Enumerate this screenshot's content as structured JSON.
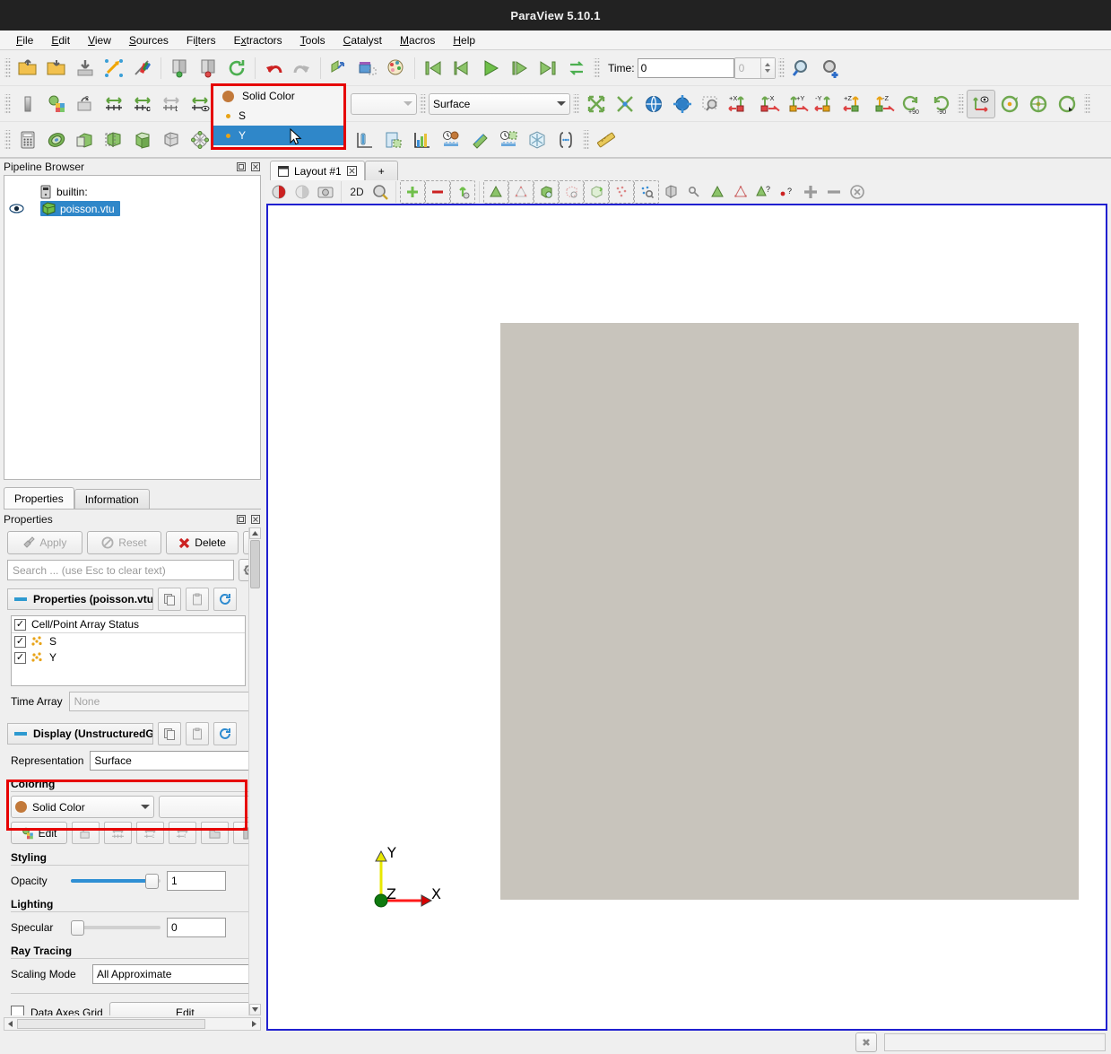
{
  "window": {
    "title": "ParaView 5.10.1"
  },
  "menu": {
    "items": [
      "File",
      "Edit",
      "View",
      "Sources",
      "Filters",
      "Extractors",
      "Tools",
      "Catalyst",
      "Macros",
      "Help"
    ]
  },
  "toolbar": {
    "time_label": "Time:",
    "time_value": "0",
    "time_index": "0",
    "representation_value": "Surface",
    "array_value": ""
  },
  "color_dropdown": {
    "items": [
      {
        "label": "Solid Color",
        "marker": "big-dot",
        "selected": false
      },
      {
        "label": "S",
        "marker": "small-dot",
        "selected": false
      },
      {
        "label": "Y",
        "marker": "small-dot",
        "selected": true
      }
    ]
  },
  "pipeline_browser": {
    "title": "Pipeline Browser",
    "server": "builtin:",
    "source": "poisson.vtu"
  },
  "panel_tabs": {
    "items": [
      "Properties",
      "Information"
    ],
    "active": "Properties"
  },
  "properties": {
    "title": "Properties",
    "apply_label": "Apply",
    "reset_label": "Reset",
    "delete_label": "Delete",
    "help_label": "?",
    "search_placeholder": "Search ... (use Esc to clear text)",
    "group_source": "Properties (poisson.vtu",
    "array_status_label": "Cell/Point Array Status",
    "arrays": [
      {
        "name": "S",
        "checked": true
      },
      {
        "name": "Y",
        "checked": true
      }
    ],
    "time_array_label": "Time Array",
    "time_array_value": "None",
    "group_display": "Display (UnstructuredG",
    "representation_label": "Representation",
    "representation_value": "Surface",
    "coloring_label": "Coloring",
    "coloring_value": "Solid Color",
    "coloring_component": "",
    "edit_label": "Edit",
    "styling_label": "Styling",
    "opacity_label": "Opacity",
    "opacity_value": "1",
    "lighting_label": "Lighting",
    "specular_label": "Specular",
    "specular_value": "0",
    "ray_tracing_label": "Ray Tracing",
    "scaling_mode_label": "Scaling Mode",
    "scaling_mode_value": "All Approximate",
    "data_axes_grid_label": "Data Axes Grid",
    "data_axes_grid_checked": false,
    "data_axes_edit_label": "Edit"
  },
  "layout": {
    "tab_label": "Layout #1",
    "add_tab_label": "+",
    "view_toolbar_2d_label": "2D"
  },
  "render_view": {
    "axes": {
      "x": "X",
      "y": "Y",
      "z": "Z"
    },
    "mesh_color": "#c8c4bc",
    "background_color": "#ffffff",
    "border_color": "#2020d0"
  },
  "highlights": {
    "annotation_color": "#e60000"
  },
  "colors": {
    "selection_blue": "#2f87c9",
    "solid_color_swatch": "#c2793a",
    "array_dot": "#e8a317",
    "titlebar": "#222222"
  }
}
